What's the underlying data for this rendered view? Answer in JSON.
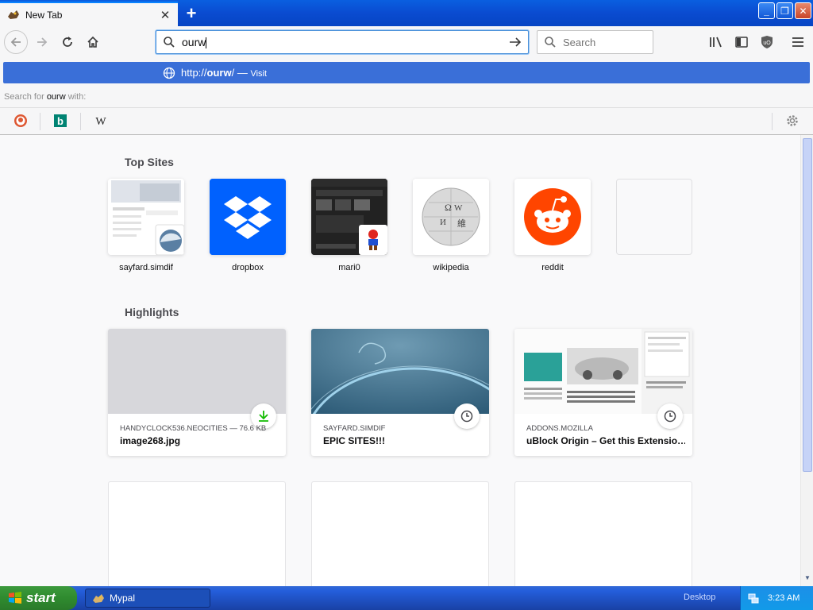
{
  "tab": {
    "title": "New Tab",
    "close_glyph": "✕"
  },
  "newtab_glyph": "+",
  "window_controls": {
    "minimize": "_",
    "restore": "❐",
    "close": "✕"
  },
  "url_bar": {
    "value": "ourw"
  },
  "search_bar": {
    "placeholder": "Search"
  },
  "suggestion": {
    "url_prefix": "http://",
    "url_bold": "ourw",
    "url_suffix": "/",
    "dash": " — ",
    "action": "Visit"
  },
  "search_for": {
    "prefix": "Search for ",
    "term": "ourw",
    "suffix": " with:"
  },
  "engines": [
    {
      "name": "DuckDuckGo",
      "icon": "duckduckgo-icon"
    },
    {
      "name": "Bing",
      "icon": "bing-icon",
      "glyph": "b"
    },
    {
      "name": "Wikipedia",
      "icon": "wikipedia-icon",
      "glyph": "W"
    }
  ],
  "top_sites": {
    "title": "Top Sites",
    "items": [
      {
        "label": "sayfard.simdif"
      },
      {
        "label": "dropbox"
      },
      {
        "label": "mari0"
      },
      {
        "label": "wikipedia"
      },
      {
        "label": "reddit"
      },
      {
        "label": ""
      }
    ]
  },
  "highlights": {
    "title": "Highlights",
    "cards": [
      {
        "meta": "HANDYCLOCK536.NEOCITIES — 76.6 KB",
        "title": "image268.jpg",
        "badge": "download-icon"
      },
      {
        "meta": "SAYFARD.SIMDIF",
        "title": "EPIC SITES!!!",
        "badge": "clock-icon"
      },
      {
        "meta": "ADDONS.MOZILLA",
        "title": "uBlock Origin – Get this Extensio…",
        "badge": "clock-icon"
      }
    ]
  },
  "taskbar": {
    "start": "start",
    "task": "Mypal",
    "desktop": "Desktop",
    "time": "3:23 AM"
  },
  "colors": {
    "accent": "#3a6fd8",
    "taskbar": "#245edb",
    "start": "#2f8b2f"
  }
}
